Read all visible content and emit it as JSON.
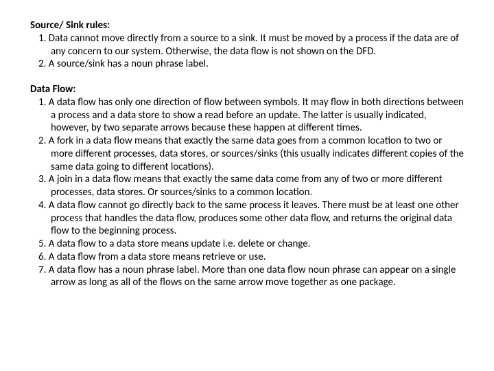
{
  "section1": {
    "heading": "Source/ Sink rules:",
    "items": [
      {
        "num": "1.",
        "text": "Data cannot move directly from a source to a sink. It must be moved by a process if the data are of any concern to our system. Otherwise, the data flow is not shown on the DFD."
      },
      {
        "num": "2.",
        "text": "A source/sink has a noun phrase label."
      }
    ]
  },
  "section2": {
    "heading": "Data Flow:",
    "items": [
      {
        "num": "1.",
        "text": "A data flow has only one direction of flow between symbols. It may flow in both directions between a process and a data store to show a read before an update. The latter is usually indicated, however, by two separate arrows because these happen at different times."
      },
      {
        "num": "2.",
        "text": "A fork in a data flow means that exactly the same data goes from a common location to two or more different processes, data stores, or sources/sinks (this usually indicates different copies of the same data going to different locations)."
      },
      {
        "num": "3.",
        "text": "A join in a data flow means that exactly the same data come from any of two or more different processes, data stores. Or sources/sinks to a common location."
      },
      {
        "num": "4.",
        "text": "A data flow cannot go directly back to the same process it leaves. There must be at least one other process that handles the data flow, produces some other data flow, and returns the original data flow to the beginning process."
      },
      {
        "num": "5.",
        "text": "A data flow to a data store means update i.e. delete or change."
      },
      {
        "num": "6.",
        "text": "A data flow from a data store means retrieve or use."
      },
      {
        "num": "7.",
        "text": "A data flow has a noun phrase label. More than one data flow noun phrase can appear on a single arrow as long as all of the flows on the same arrow move together as one package."
      }
    ]
  }
}
